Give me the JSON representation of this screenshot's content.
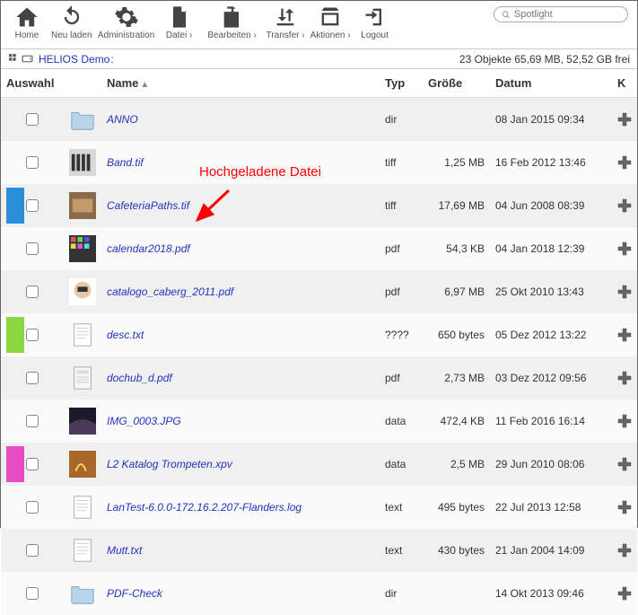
{
  "toolbar": {
    "home": "Home",
    "reload": "Neu laden",
    "admin": "Administration",
    "file": "Datei ›",
    "edit": "Bearbeiten ›",
    "transfer": "Transfer ›",
    "actions": "Aktionen ›",
    "logout": "Logout"
  },
  "spotlight": {
    "placeholder": "Spotlight"
  },
  "breadcrumb": {
    "root": "HELIOS Demo",
    "sep": ":"
  },
  "status": "23 Objekte 65,69 MB, 52,52 GB frei",
  "columns": {
    "select": "Auswahl",
    "name": "Name",
    "type": "Typ",
    "size": "Größe",
    "date": "Datum",
    "k": "K"
  },
  "annotation": "Hochgeladene Datei",
  "rows": [
    {
      "color": "",
      "name": "ANNO",
      "type": "dir",
      "size": "",
      "date": "08 Jan 2015 09:34",
      "icon": "folder"
    },
    {
      "color": "",
      "name": "Band.tif",
      "type": "tiff",
      "size": "1,25 MB",
      "date": "16 Feb 2012 13:46",
      "icon": "photo1"
    },
    {
      "color": "#2a8fd8",
      "name": "CafeteriaPaths.tif",
      "type": "tiff",
      "size": "17,69 MB",
      "date": "04 Jun 2008 08:39",
      "icon": "photo2"
    },
    {
      "color": "",
      "name": "calendar2018.pdf",
      "type": "pdf",
      "size": "54,3 KB",
      "date": "04 Jan 2018 12:39",
      "icon": "calendar"
    },
    {
      "color": "",
      "name": "catalogo_caberg_2011.pdf",
      "type": "pdf",
      "size": "6,97 MB",
      "date": "25 Okt 2010 13:43",
      "icon": "helmet"
    },
    {
      "color": "#8ed641",
      "name": "desc.txt",
      "type": "????",
      "size": "650 bytes",
      "date": "05 Dez 2012 13:22",
      "icon": "text"
    },
    {
      "color": "",
      "name": "dochub_d.pdf",
      "type": "pdf",
      "size": "2,73 MB",
      "date": "03 Dez 2012 09:56",
      "icon": "doc"
    },
    {
      "color": "",
      "name": "IMG_0003.JPG",
      "type": "data",
      "size": "472,4 KB",
      "date": "11 Feb 2016 16:14",
      "icon": "photo3"
    },
    {
      "color": "#e84cc3",
      "name": "L2 Katalog Trompeten.xpv",
      "type": "data",
      "size": "2,5 MB",
      "date": "29 Jun 2010 08:06",
      "icon": "photo4"
    },
    {
      "color": "",
      "name": "LanTest-6.0.0-172.16.2.207-Flanders.log",
      "type": "text",
      "size": "495 bytes",
      "date": "22 Jul 2013 12:58",
      "icon": "text"
    },
    {
      "color": "",
      "name": "Mutt.txt",
      "type": "text",
      "size": "430 bytes",
      "date": "21 Jan 2004 14:09",
      "icon": "text"
    },
    {
      "color": "",
      "name": "PDF-Check",
      "type": "dir",
      "size": "",
      "date": "14 Okt 2013 09:46",
      "icon": "folder"
    }
  ]
}
